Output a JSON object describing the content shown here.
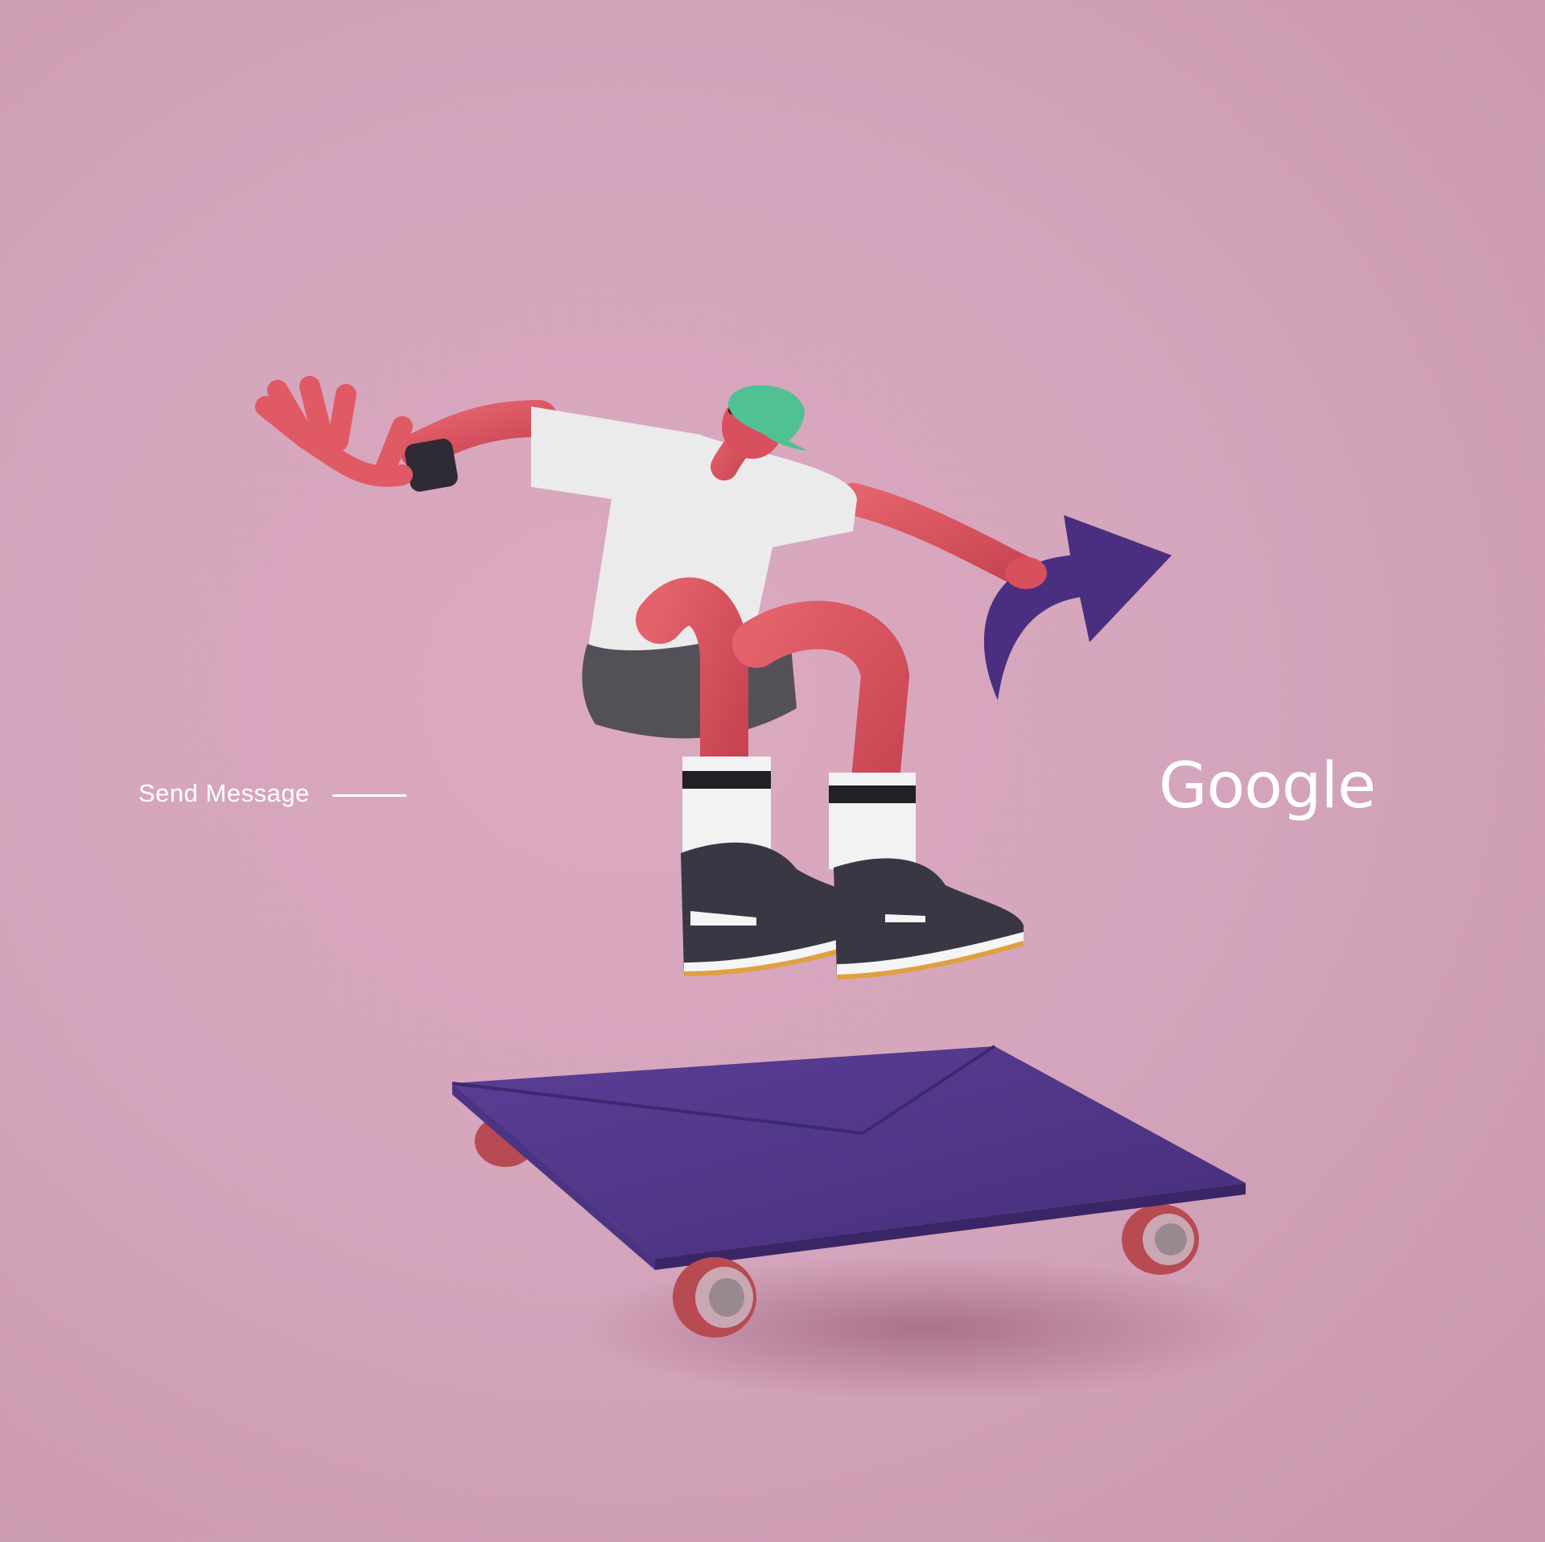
{
  "caption": {
    "text": "Send Message"
  },
  "brand": {
    "logo_text": "Google"
  },
  "colors": {
    "background": "#d4a5bc",
    "envelope": "#4f3686",
    "arrow": "#4a2f80",
    "skin": "#d8505d",
    "cap": "#4fc193",
    "shirt": "#ecebec",
    "shorts": "#545058",
    "shoe": "#3a3744",
    "wheel": "#b84a52"
  }
}
